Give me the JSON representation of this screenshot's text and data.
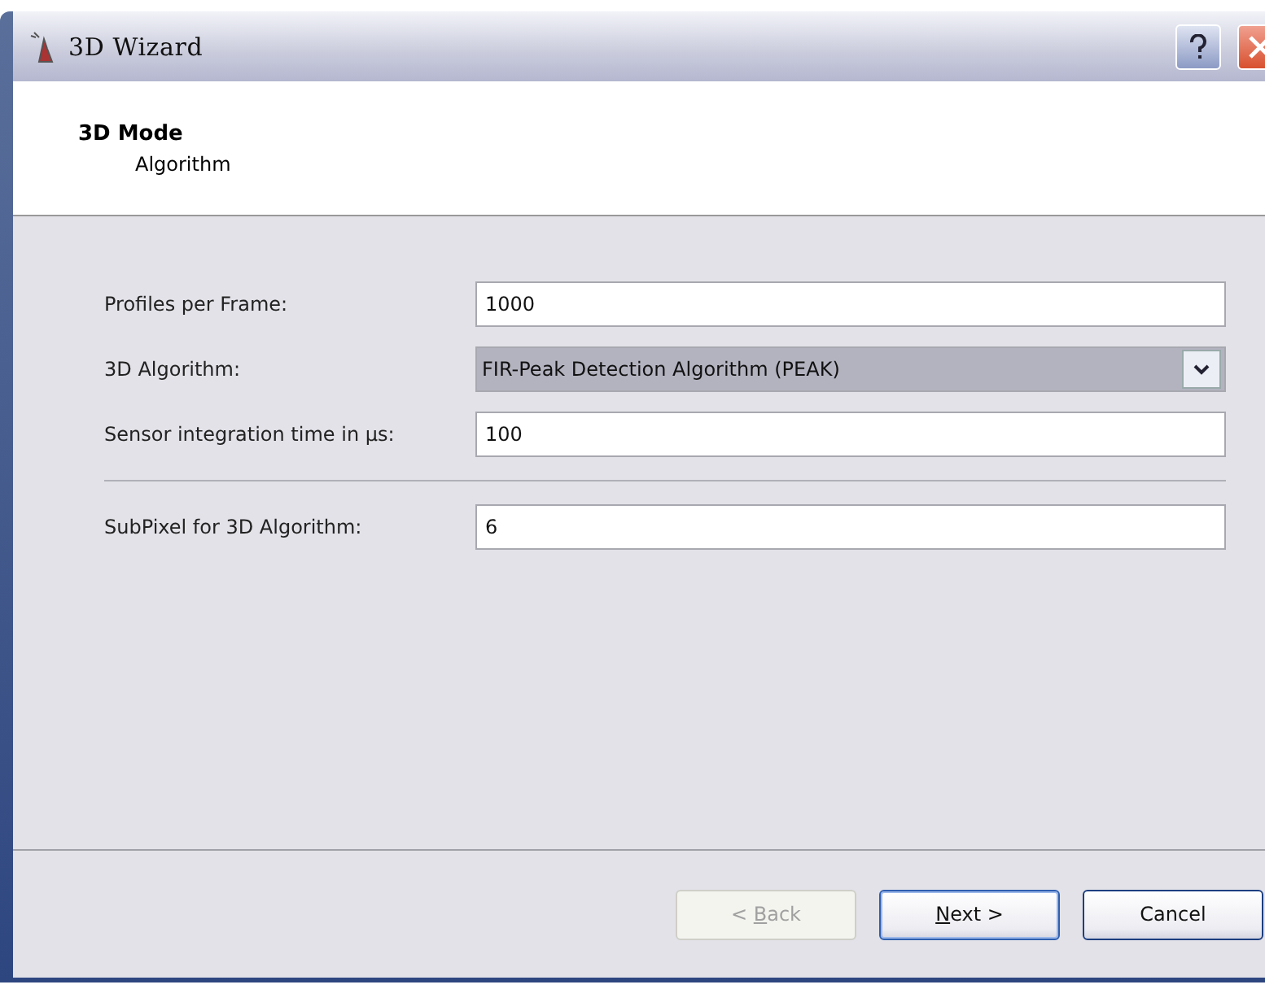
{
  "window": {
    "title": "3D Wizard"
  },
  "header": {
    "title": "3D Mode",
    "subtitle": "Algorithm"
  },
  "fields": [
    {
      "kind": "text",
      "label": "Profiles per Frame:",
      "value": "1000"
    },
    {
      "kind": "select",
      "label": "3D Algorithm:",
      "value": "FIR-Peak Detection Algorithm (PEAK)"
    },
    {
      "kind": "text",
      "label": "Sensor integration time in µs:",
      "value": "100"
    },
    {
      "kind": "separator"
    },
    {
      "kind": "text",
      "label": "SubPixel for 3D Algorithm:",
      "value": "6"
    }
  ],
  "buttons": [
    {
      "before": "< ",
      "key": "B",
      "after": "ack",
      "disabled": true,
      "default": false
    },
    {
      "key": "N",
      "after": "ext >",
      "disabled": false,
      "default": true
    },
    {
      "before": "Cancel",
      "disabled": false,
      "default": false
    }
  ]
}
